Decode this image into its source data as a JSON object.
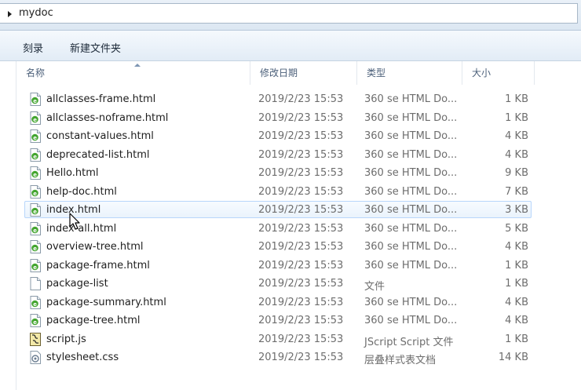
{
  "address": {
    "folder": "mydoc"
  },
  "toolbar": {
    "burn_label": "刻录",
    "new_folder_label": "新建文件夹"
  },
  "columns": {
    "name": "名称",
    "modified": "修改日期",
    "type": "类型",
    "size": "大小"
  },
  "files": [
    {
      "name": "allclasses-frame.html",
      "modified": "2019/2/23 15:53",
      "type": "360 se HTML Do...",
      "size": "1 KB",
      "icon": "html-file-icon"
    },
    {
      "name": "allclasses-noframe.html",
      "modified": "2019/2/23 15:53",
      "type": "360 se HTML Do...",
      "size": "1 KB",
      "icon": "html-file-icon"
    },
    {
      "name": "constant-values.html",
      "modified": "2019/2/23 15:53",
      "type": "360 se HTML Do...",
      "size": "4 KB",
      "icon": "html-file-icon"
    },
    {
      "name": "deprecated-list.html",
      "modified": "2019/2/23 15:53",
      "type": "360 se HTML Do...",
      "size": "4 KB",
      "icon": "html-file-icon"
    },
    {
      "name": "Hello.html",
      "modified": "2019/2/23 15:53",
      "type": "360 se HTML Do...",
      "size": "9 KB",
      "icon": "html-file-icon"
    },
    {
      "name": "help-doc.html",
      "modified": "2019/2/23 15:53",
      "type": "360 se HTML Do...",
      "size": "7 KB",
      "icon": "html-file-icon"
    },
    {
      "name": "index.html",
      "modified": "2019/2/23 15:53",
      "type": "360 se HTML Do...",
      "size": "3 KB",
      "icon": "html-file-icon"
    },
    {
      "name": "index-all.html",
      "modified": "2019/2/23 15:53",
      "type": "360 se HTML Do...",
      "size": "5 KB",
      "icon": "html-file-icon"
    },
    {
      "name": "overview-tree.html",
      "modified": "2019/2/23 15:53",
      "type": "360 se HTML Do...",
      "size": "4 KB",
      "icon": "html-file-icon"
    },
    {
      "name": "package-frame.html",
      "modified": "2019/2/23 15:53",
      "type": "360 se HTML Do...",
      "size": "1 KB",
      "icon": "html-file-icon"
    },
    {
      "name": "package-list",
      "modified": "2019/2/23 15:53",
      "type": "文件",
      "size": "1 KB",
      "icon": "blank-file-icon"
    },
    {
      "name": "package-summary.html",
      "modified": "2019/2/23 15:53",
      "type": "360 se HTML Do...",
      "size": "4 KB",
      "icon": "html-file-icon"
    },
    {
      "name": "package-tree.html",
      "modified": "2019/2/23 15:53",
      "type": "360 se HTML Do...",
      "size": "4 KB",
      "icon": "html-file-icon"
    },
    {
      "name": "script.js",
      "modified": "2019/2/23 15:53",
      "type": "JScript Script 文件",
      "size": "1 KB",
      "icon": "script-file-icon"
    },
    {
      "name": "stylesheet.css",
      "modified": "2019/2/23 15:53",
      "type": "层叠样式表文档",
      "size": "14 KB",
      "icon": "css-file-icon"
    }
  ],
  "hovered_file": "index.html",
  "colors": {
    "hover_border": "#b8d6fb",
    "header_text": "#4c607a",
    "html_icon_green": "#3a9a2a"
  }
}
